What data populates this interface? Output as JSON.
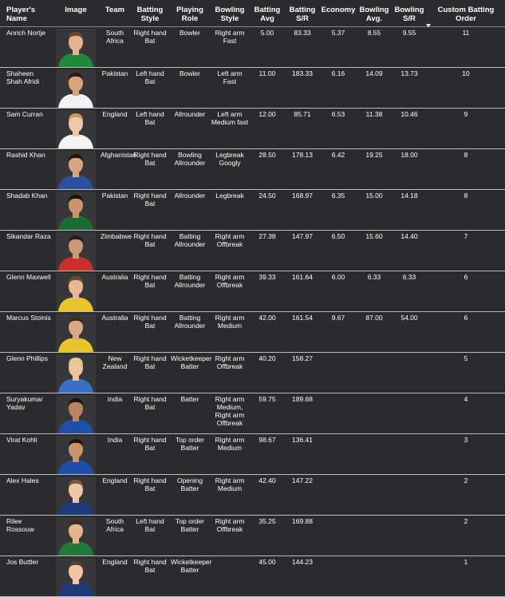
{
  "headers": {
    "name": "Player's Name",
    "image": "Image",
    "team": "Team",
    "batting_style": "Batting Style",
    "playing_role": "Playing Role",
    "bowling_style": "Bowling Style",
    "batting_avg": "Batting Avg",
    "batting_sr": "Batting S/R",
    "economy": "Economy",
    "bowling_avg": "Bowling Avg.",
    "bowling_sr": "Bowling S/R",
    "custom_order": "Custom Batting Order"
  },
  "rows": [
    {
      "name": "Anrich Nortje",
      "team": "South Africa",
      "batting_style": "Right hand Bat",
      "role": "Bowler",
      "bowling_style": "Right arm Fast",
      "bat_avg": "5.00",
      "bat_sr": "83.33",
      "economy": "5.37",
      "bowl_avg": "8.55",
      "bowl_sr": "9.55",
      "order": "11",
      "shirt": "#1f8a3a",
      "skin": "#e3b48d",
      "hair": "#6b4a2b"
    },
    {
      "name": "Shaheen Shah Afridi",
      "team": "Pakistan",
      "batting_style": "Left hand Bat",
      "role": "Bowler",
      "bowling_style": "Left arm Fast",
      "bat_avg": "11.00",
      "bat_sr": "183.33",
      "economy": "6.16",
      "bowl_avg": "14.09",
      "bowl_sr": "13.73",
      "order": "10",
      "shirt": "#f2f2f2",
      "skin": "#d8a57d",
      "hair": "#2a1c12"
    },
    {
      "name": "Sam Curran",
      "team": "England",
      "batting_style": "Left hand Bat",
      "role": "Allrounder",
      "bowling_style": "Left arm Medium fast",
      "bat_avg": "12.00",
      "bat_sr": "85.71",
      "economy": "6.53",
      "bowl_avg": "11.38",
      "bowl_sr": "10.46",
      "order": "9",
      "shirt": "#f4f4f4",
      "skin": "#f0c7a8",
      "hair": "#c99b55"
    },
    {
      "name": "Rashid Khan",
      "team": "Afghanistan",
      "batting_style": "Right hand Bat",
      "role": "Bowling Allrounder",
      "bowling_style": "Legbreak Googly",
      "bat_avg": "28.50",
      "bat_sr": "178.13",
      "economy": "6.42",
      "bowl_avg": "19.25",
      "bowl_sr": "18.00",
      "order": "8",
      "shirt": "#2a4f9e",
      "skin": "#d6a582",
      "hair": "#1d1510"
    },
    {
      "name": "Shadab Khan",
      "team": "Pakistan",
      "batting_style": "Right hand Bat",
      "role": "Allrounder",
      "bowling_style": "Legbreak",
      "bat_avg": "24.50",
      "bat_sr": "168.97",
      "economy": "6.35",
      "bowl_avg": "15.00",
      "bowl_sr": "14.18",
      "order": "8",
      "shirt": "#1c6b35",
      "skin": "#c9956d",
      "hair": "#1d1510"
    },
    {
      "name": "Sikandar Raza",
      "team": "Zimbabwe",
      "batting_style": "Right hand Bat",
      "role": "Batting Allrounder",
      "bowling_style": "Right arm Offbreak",
      "bat_avg": "27.38",
      "bat_sr": "147.97",
      "economy": "6.50",
      "bowl_avg": "15.60",
      "bowl_sr": "14.40",
      "order": "7",
      "shirt": "#c9302c",
      "skin": "#c99a74",
      "hair": "#2a1c12"
    },
    {
      "name": "Glenn Maxwell",
      "team": "Australia",
      "batting_style": "Right hand Bat",
      "role": "Batting Allrounder",
      "bowling_style": "Right arm Offbreak",
      "bat_avg": "39.33",
      "bat_sr": "161.64",
      "economy": "6.00",
      "bowl_avg": "6.33",
      "bowl_sr": "6.33",
      "order": "6",
      "shirt": "#e8c62a",
      "skin": "#e6b894",
      "hair": "#6b4a2b"
    },
    {
      "name": "Marcus Stoinis",
      "team": "Australia",
      "batting_style": "Right hand Bat",
      "role": "Batting Allrounder",
      "bowling_style": "Right arm Medium",
      "bat_avg": "42.00",
      "bat_sr": "161.54",
      "economy": "9.67",
      "bowl_avg": "87.00",
      "bowl_sr": "54.00",
      "order": "6",
      "shirt": "#e8c62a",
      "skin": "#d9a983",
      "hair": "#3d2a1a"
    },
    {
      "name": "Glenn Phillips",
      "team": "New Zealand",
      "batting_style": "Right hand Bat",
      "role": "Wicketkeeper Batter",
      "bowling_style": "Right arm Offbreak",
      "bat_avg": "40.20",
      "bat_sr": "158.27",
      "economy": "",
      "bowl_avg": "",
      "bowl_sr": "",
      "order": "5",
      "shirt": "#3a6fc4",
      "skin": "#ecc2a0",
      "hair": "#e2c98a"
    },
    {
      "name": "Suryakumar Yadav",
      "team": "India",
      "batting_style": "Right hand Bat",
      "role": "Batter",
      "bowling_style": "Right arm Medium, Right arm Offbreak",
      "bat_avg": "59.75",
      "bat_sr": "189.68",
      "economy": "",
      "bowl_avg": "",
      "bowl_sr": "",
      "order": "4",
      "shirt": "#1f4fa8",
      "skin": "#b98461",
      "hair": "#1d1510"
    },
    {
      "name": "Virat Kohli",
      "team": "India",
      "batting_style": "Right hand Bat",
      "role": "Top order Batter",
      "bowling_style": "Right arm Medium",
      "bat_avg": "98.67",
      "bat_sr": "136.41",
      "economy": "",
      "bowl_avg": "",
      "bowl_sr": "",
      "order": "3",
      "shirt": "#1f4fa8",
      "skin": "#c8946d",
      "hair": "#1d1510"
    },
    {
      "name": "Alex Hales",
      "team": "England",
      "batting_style": "Right hand Bat",
      "role": "Opening Batter",
      "bowling_style": "Right arm Medium",
      "bat_avg": "42.40",
      "bat_sr": "147.22",
      "economy": "",
      "bowl_avg": "",
      "bowl_sr": "",
      "order": "2",
      "shirt": "#1e3a7a",
      "skin": "#f0c6a6",
      "hair": "#7a5a3a"
    },
    {
      "name": "Rilee Rossouw",
      "team": "South Africa",
      "batting_style": "Left hand Bat",
      "role": "Top order Batter",
      "bowling_style": "Right arm Offbreak",
      "bat_avg": "35.25",
      "bat_sr": "169.88",
      "economy": "",
      "bowl_avg": "",
      "bowl_sr": "",
      "order": "2",
      "shirt": "#1f7a3a",
      "skin": "#e3b48d",
      "hair": "#3d2a1a"
    },
    {
      "name": "Jos Buttler",
      "team": "England",
      "batting_style": "Right hand Bat",
      "role": "Wicketkeeper Batter",
      "bowling_style": "",
      "bat_avg": "45.00",
      "bat_sr": "144.23",
      "economy": "",
      "bowl_avg": "",
      "bowl_sr": "",
      "order": "1",
      "shirt": "#1e3a7a",
      "skin": "#f0c6a6",
      "hair": "#5a3f2a"
    }
  ]
}
